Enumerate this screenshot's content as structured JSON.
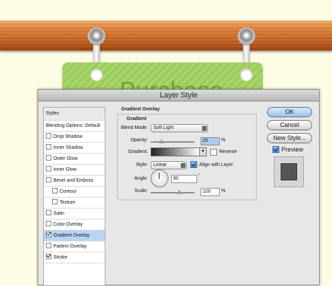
{
  "background": {
    "page": "#fdfde6",
    "board": "#d0712c",
    "card": "#a4d164",
    "card_text": "Purchase"
  },
  "dialog": {
    "title": "Layer Style",
    "sidebar": {
      "items": [
        {
          "label": "Styles",
          "checkbox": false,
          "checked": false,
          "selected": false
        },
        {
          "label": "Blending Options: Default",
          "checkbox": false,
          "checked": false,
          "selected": false
        },
        {
          "label": "Drop Shadow",
          "checkbox": true,
          "checked": false,
          "selected": false
        },
        {
          "label": "Inner Shadow",
          "checkbox": true,
          "checked": false,
          "selected": false
        },
        {
          "label": "Outer Glow",
          "checkbox": true,
          "checked": false,
          "selected": false
        },
        {
          "label": "Inner Glow",
          "checkbox": true,
          "checked": false,
          "selected": false
        },
        {
          "label": "Bevel and Emboss",
          "checkbox": true,
          "checked": false,
          "selected": false
        },
        {
          "label": "Contour",
          "checkbox": true,
          "checked": false,
          "selected": false,
          "sub": true
        },
        {
          "label": "Texture",
          "checkbox": true,
          "checked": false,
          "selected": false,
          "sub": true
        },
        {
          "label": "Satin",
          "checkbox": true,
          "checked": false,
          "selected": false
        },
        {
          "label": "Color Overlay",
          "checkbox": true,
          "checked": false,
          "selected": false
        },
        {
          "label": "Gradient Overlay",
          "checkbox": true,
          "checked": true,
          "selected": true
        },
        {
          "label": "Pattern Overlay",
          "checkbox": true,
          "checked": false,
          "selected": false
        },
        {
          "label": "Stroke",
          "checkbox": true,
          "checked": true,
          "selected": false
        }
      ]
    },
    "panel": {
      "section_title": "Gradient Overlay",
      "group_title": "Gradient",
      "blend_mode_label": "Blend Mode:",
      "blend_mode_value": "Soft Light",
      "opacity_label": "Opacity:",
      "opacity_value": "25",
      "opacity_level": 0.25,
      "percent": "%",
      "gradient_label": "Gradient:",
      "reverse_label": "Reverse",
      "reverse_checked": false,
      "style_label": "Style:",
      "style_value": "Linear",
      "align_label": "Align with Layer",
      "align_checked": true,
      "angle_label": "Angle:",
      "angle_value": "90",
      "degree": "°",
      "scale_label": "Scale:",
      "scale_value": "100",
      "scale_level": 1.0
    },
    "buttons": {
      "ok": "OK",
      "cancel": "Cancel",
      "new_style": "New Style..."
    },
    "preview": {
      "label": "Preview",
      "checked": true
    }
  }
}
